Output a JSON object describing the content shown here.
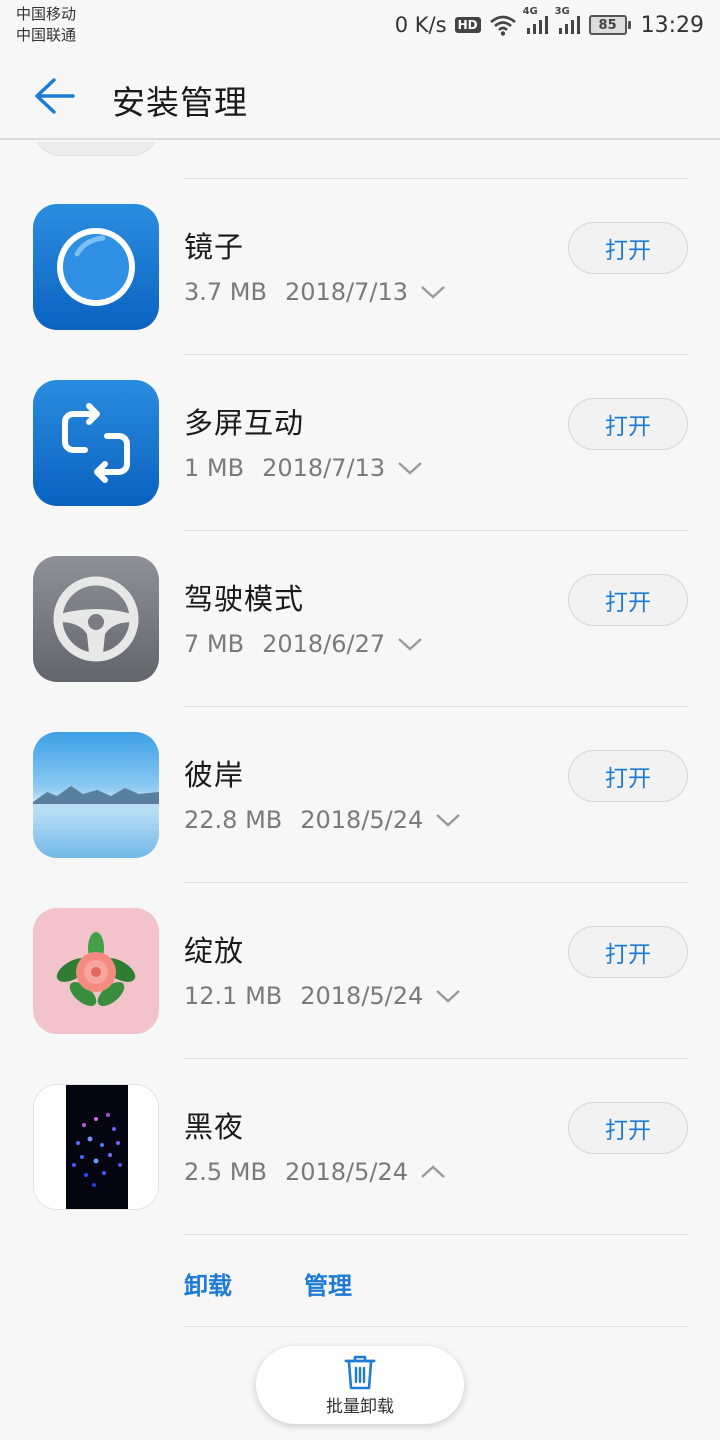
{
  "status_bar": {
    "carrier_1": "中国移动",
    "carrier_2": "中国联通",
    "net_speed": "0 K/s",
    "hd_badge": "HD",
    "signal_1_type": "4G",
    "signal_2_type": "3G",
    "battery_level": "85",
    "time": "13:29"
  },
  "header": {
    "title": "安装管理"
  },
  "apps": [
    {
      "name": "镜子",
      "size": "3.7 MB",
      "date": "2018/7/13",
      "open_label": "打开",
      "expanded": false,
      "icon": "mirror-icon"
    },
    {
      "name": "多屏互动",
      "size": "1 MB",
      "date": "2018/7/13",
      "open_label": "打开",
      "expanded": false,
      "icon": "multiscreen-icon"
    },
    {
      "name": "驾驶模式",
      "size": "7 MB",
      "date": "2018/6/27",
      "open_label": "打开",
      "expanded": false,
      "icon": "steering-wheel-icon"
    },
    {
      "name": "彼岸",
      "size": "22.8 MB",
      "date": "2018/5/24",
      "open_label": "打开",
      "expanded": false,
      "icon": "lake-landscape-icon"
    },
    {
      "name": "绽放",
      "size": "12.1 MB",
      "date": "2018/5/24",
      "open_label": "打开",
      "expanded": false,
      "icon": "rose-icon"
    },
    {
      "name": "黑夜",
      "size": "2.5 MB",
      "date": "2018/5/24",
      "open_label": "打开",
      "expanded": true,
      "icon": "night-theme-icon"
    }
  ],
  "expanded_actions": {
    "uninstall": "卸载",
    "manage": "管理"
  },
  "batch_uninstall": {
    "label": "批量卸载"
  },
  "colors": {
    "accent": "#1e7bd4",
    "background": "#f7f7f7"
  }
}
